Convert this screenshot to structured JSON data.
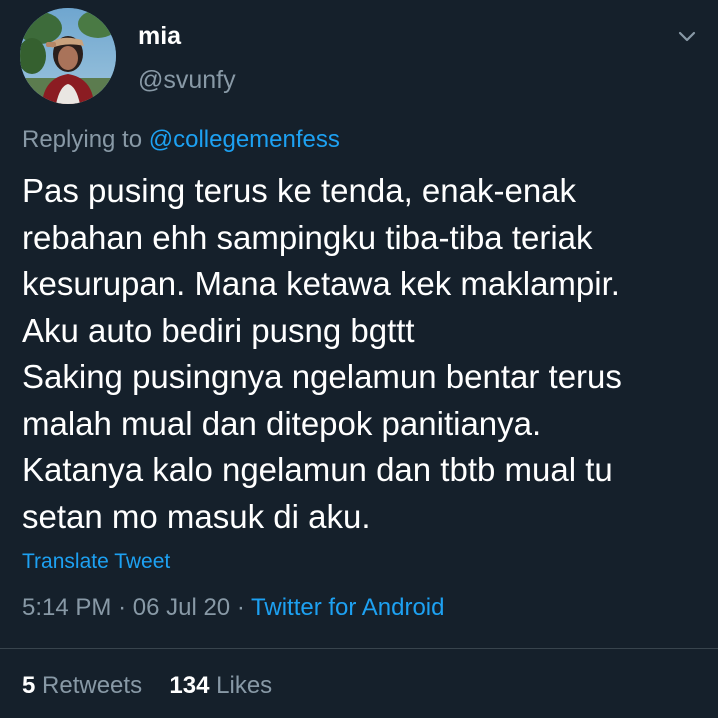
{
  "user": {
    "display_name": "mia",
    "handle": "@svunfy",
    "avatar_icon": "profile-photo"
  },
  "reply": {
    "prefix": "Replying to",
    "mention": "@collegemenfess"
  },
  "tweet": {
    "lines": [
      "Pas pusing terus ke tenda, enak-enak",
      "rebahan ehh sampingku tiba-tiba teriak",
      "kesurupan. Mana ketawa kek maklampir.",
      "Aku auto bediri pusng bgttt",
      "Saking pusingnya ngelamun bentar terus",
      "malah mual dan ditepok panitianya.",
      "Katanya kalo ngelamun dan tbtb mual tu",
      "setan mo masuk di aku."
    ],
    "translate_label": "Translate Tweet"
  },
  "meta": {
    "time": "5:14 PM",
    "separator": "·",
    "date": "06 Jul 20",
    "source": "Twitter for Android"
  },
  "stats": {
    "retweets_count": "5",
    "retweets_label": "Retweets",
    "likes_count": "134",
    "likes_label": "Likes"
  },
  "colors": {
    "background": "#15202b",
    "text": "#ffffff",
    "muted": "#8899a6",
    "accent": "#1da1f2",
    "divider": "#38444d"
  }
}
